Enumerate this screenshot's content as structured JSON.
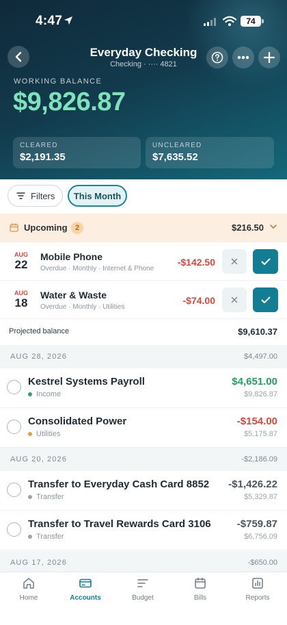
{
  "status_bar": {
    "time": "4:47",
    "battery": "74"
  },
  "header": {
    "title": "Everyday Checking",
    "subtitle": "Checking · ···· 4821",
    "working_balance_label": "WORKING BALANCE",
    "working_balance": "$9,826.87",
    "cleared_label": "CLEARED",
    "cleared_value": "$2,191.35",
    "uncleared_label": "UNCLEARED",
    "uncleared_value": "$7,635.52"
  },
  "filters": {
    "filters_label": "Filters",
    "period_label": "This Month"
  },
  "upcoming": {
    "label": "Upcoming",
    "count": "2",
    "total": "$216.50",
    "items": [
      {
        "month": "AUG",
        "day": "22",
        "name": "Mobile Phone",
        "meta": "Overdue · Monthly · Internet & Phone",
        "amount": "-$142.50"
      },
      {
        "month": "AUG",
        "day": "18",
        "name": "Water & Waste",
        "meta": "Overdue · Monthly · Utilities",
        "amount": "-$74.00"
      }
    ],
    "projected_label": "Projected balance",
    "projected_value": "$9,610.37"
  },
  "groups": [
    {
      "date": "AUG 28, 2026",
      "total": "$4,497.00",
      "transactions": [
        {
          "name": "Kestrel Systems Payroll",
          "category": "Income",
          "category_color": "#2fa564",
          "amount": "$4,651.00",
          "amount_color": "#23a05f",
          "balance": "$9,826.87"
        },
        {
          "name": "Consolidated Power",
          "category": "Utilities",
          "category_color": "#ee9a3a",
          "amount": "-$154.00",
          "amount_color": "#d9473b",
          "balance": "$5,175.87"
        }
      ]
    },
    {
      "date": "AUG 20, 2026",
      "total": "-$2,186.09",
      "transactions": [
        {
          "name": "Transfer to Everyday Cash Card 8852",
          "category": "Transfer",
          "category_color": "#9aa6ae",
          "amount": "-$1,426.22",
          "amount_color": "#4a5863",
          "balance": "$5,329.87"
        },
        {
          "name": "Transfer to Travel Rewards Card 3106",
          "category": "Transfer",
          "category_color": "#9aa6ae",
          "amount": "-$759.87",
          "amount_color": "#4a5863",
          "balance": "$6,756.09"
        }
      ]
    },
    {
      "date": "AUG 17, 2026",
      "total": "-$650.00",
      "transactions": []
    }
  ],
  "nav": {
    "items": [
      {
        "label": "Home",
        "icon": "home-icon"
      },
      {
        "label": "Accounts",
        "icon": "card-icon"
      },
      {
        "label": "Budget",
        "icon": "list-icon"
      },
      {
        "label": "Bills",
        "icon": "calendar-icon"
      },
      {
        "label": "Reports",
        "icon": "chart-icon"
      }
    ],
    "active": "Accounts"
  },
  "colors": {
    "accent": "#137d93",
    "balance_green": "#7ee3b9",
    "negative": "#d9473b",
    "positive": "#23a05f"
  }
}
